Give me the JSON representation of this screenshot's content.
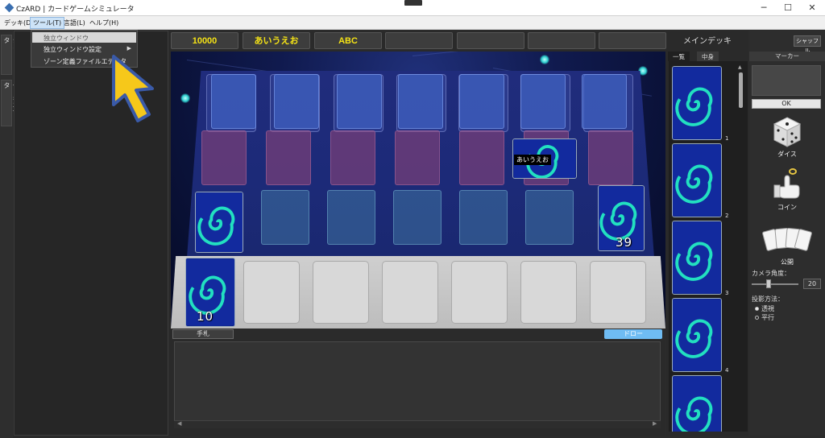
{
  "window": {
    "title": "CzARD | カードゲームシミュレータ",
    "minimize": "─",
    "maximize": "☐",
    "close": "✕"
  },
  "menu": {
    "items": [
      {
        "label": "デッキ(D)"
      },
      {
        "label": "ツール(T)"
      },
      {
        "label": "言語(L)"
      },
      {
        "label": "ヘルプ(H)"
      }
    ]
  },
  "dropdown": {
    "items": [
      {
        "label": "独立ウィンドウ"
      },
      {
        "label": "独立ウィンドウ設定"
      },
      {
        "label": "ゾーン定義ファイルエディタ"
      }
    ]
  },
  "side_tabs": [
    {
      "label": "シミュレータ"
    },
    {
      "label": "デッキエディタ"
    }
  ],
  "counters": [
    "10000",
    "あいうえお",
    "ABC",
    "",
    "",
    "",
    ""
  ],
  "field": {
    "card_label": "あいうえお",
    "deck_count": "39",
    "hand_count": "10"
  },
  "bottom": {
    "hand_tab": "手札",
    "draw_button": "ドロー"
  },
  "deck": {
    "title": "メインデッキ",
    "shuffle": "シャッフル",
    "tabs": [
      "一覧",
      "中身"
    ],
    "indices": [
      "1",
      "2",
      "3",
      "4"
    ]
  },
  "tools": {
    "marker_header": "マーカー",
    "ok": "OK",
    "dice": "ダイス",
    "coin": "コイン",
    "reveal": "公開",
    "camera_label": "カメラ角度：",
    "camera_value": "20",
    "camera_level": 0.35,
    "projection_label": "投影方法：",
    "projection_options": [
      "透視",
      "平行"
    ],
    "projection_selected": "透視"
  },
  "colors": {
    "accent": "#f5e316",
    "draw_button": "#6fbcf3",
    "pointer": "#f6c81a"
  },
  "icons": [
    "app-icon",
    "dice-icon",
    "coin-icon",
    "cards-icon",
    "pointer-arrow-icon"
  ]
}
